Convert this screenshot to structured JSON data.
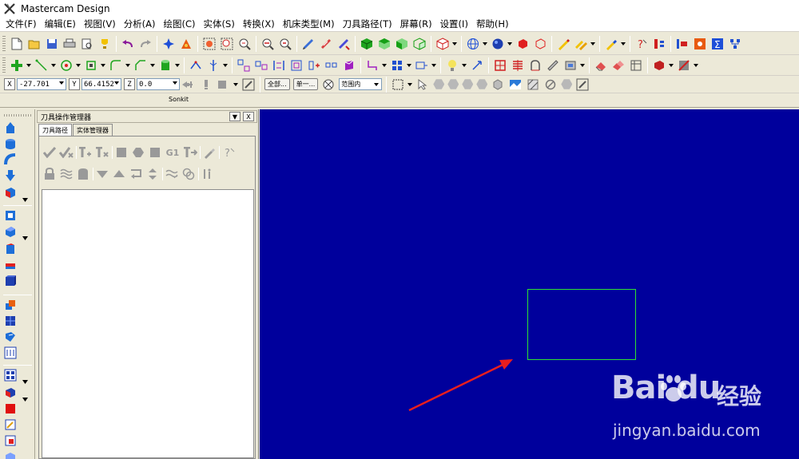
{
  "window": {
    "title": "Mastercam Design"
  },
  "menu": [
    {
      "label": "文件(F)"
    },
    {
      "label": "编辑(E)"
    },
    {
      "label": "视图(V)"
    },
    {
      "label": "分析(A)"
    },
    {
      "label": "绘图(C)"
    },
    {
      "label": "实体(S)"
    },
    {
      "label": "转换(X)"
    },
    {
      "label": "机床类型(M)"
    },
    {
      "label": "刀具路径(T)"
    },
    {
      "label": "屏幕(R)"
    },
    {
      "label": "设置(I)"
    },
    {
      "label": "帮助(H)"
    }
  ],
  "coords": {
    "x_label": "X",
    "y_label": "Y",
    "z_label": "Z",
    "x_value": "-27.701",
    "y_value": "66.4152",
    "z_value": "0.0"
  },
  "statusbar": {
    "btn1_label": "全部...",
    "btn2_label": "单一...",
    "range_value": "范围内"
  },
  "sonkit_label": "Sonkit",
  "ops_manager": {
    "title": "刀具操作管理器",
    "header_dropdown": "▼",
    "header_close": "X",
    "tabs": [
      {
        "label": "刀具路径"
      },
      {
        "label": "实体管理器"
      }
    ],
    "g1_label": "G1"
  },
  "colors": {
    "viewport_bg": "#00009c",
    "geometry": "#2fe02f",
    "arrow": "#e81e1e"
  },
  "watermark": {
    "brand": "Bai du",
    "name": "经验",
    "url": "jingyan.baidu.com"
  }
}
